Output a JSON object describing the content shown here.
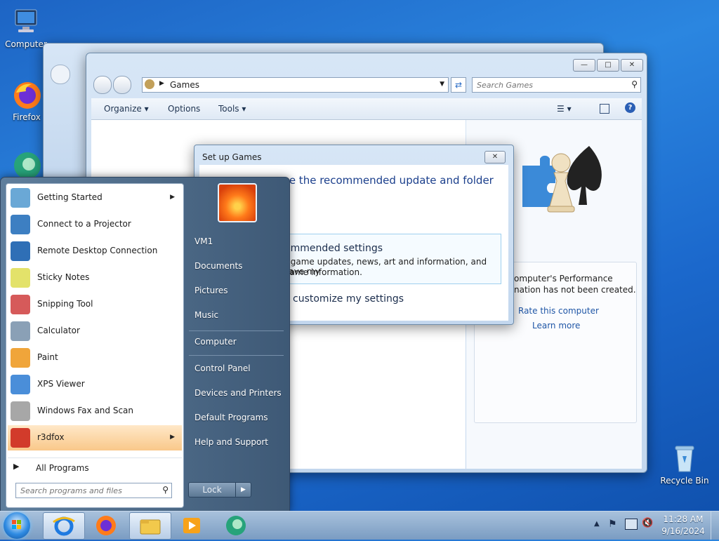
{
  "desktop": {
    "icons": [
      {
        "label": "Computer",
        "icon": "computer-icon"
      },
      {
        "label": "Firefox",
        "icon": "firefox-icon"
      },
      {
        "label": "Recycle Bin",
        "icon": "recycle-bin-icon"
      }
    ]
  },
  "explorer": {
    "breadcrumb": "Games",
    "search_placeholder": "Search Games",
    "toolbar": {
      "organize": "Organize",
      "options": "Options",
      "tools": "Tools"
    },
    "performance": {
      "line1": "omputer's Performance",
      "line2": "nation has not been created.",
      "rate_link": "Rate this computer",
      "learn_link": "Learn more"
    }
  },
  "setup_dialog": {
    "title": "Set up Games",
    "heading": "se the recommended update and folder",
    "option1_title": "ommended settings",
    "option1_desc1": "r game updates, news, art and information, and save my",
    "option1_desc2": "game information.",
    "option2_title": "o customize my settings"
  },
  "start_menu": {
    "programs": [
      {
        "label": "Getting Started",
        "icon": "getting-started-icon",
        "submenu": true
      },
      {
        "label": "Connect to a Projector",
        "icon": "projector-icon",
        "submenu": false
      },
      {
        "label": "Remote Desktop Connection",
        "icon": "remote-desktop-icon",
        "submenu": false
      },
      {
        "label": "Sticky Notes",
        "icon": "sticky-notes-icon",
        "submenu": false
      },
      {
        "label": "Snipping Tool",
        "icon": "snipping-tool-icon",
        "submenu": false
      },
      {
        "label": "Calculator",
        "icon": "calculator-icon",
        "submenu": false
      },
      {
        "label": "Paint",
        "icon": "paint-icon",
        "submenu": false
      },
      {
        "label": "XPS Viewer",
        "icon": "xps-viewer-icon",
        "submenu": false
      },
      {
        "label": "Windows Fax and Scan",
        "icon": "fax-scan-icon",
        "submenu": false
      },
      {
        "label": "r3dfox",
        "icon": "r3dfox-icon",
        "submenu": true
      }
    ],
    "all_programs": "All Programs",
    "search_placeholder": "Search programs and files",
    "right_links": [
      "VM1",
      "Documents",
      "Pictures",
      "Music",
      "Computer",
      "Control Panel",
      "Devices and Printers",
      "Default Programs",
      "Help and Support"
    ],
    "lock_label": "Lock"
  },
  "taskbar": {
    "buttons": [
      "start-orb",
      "internet-explorer-icon",
      "firefox-icon",
      "file-explorer-icon",
      "media-player-icon",
      "edge-icon"
    ],
    "clock_time": "11:28 AM",
    "clock_date": "9/16/2024"
  }
}
